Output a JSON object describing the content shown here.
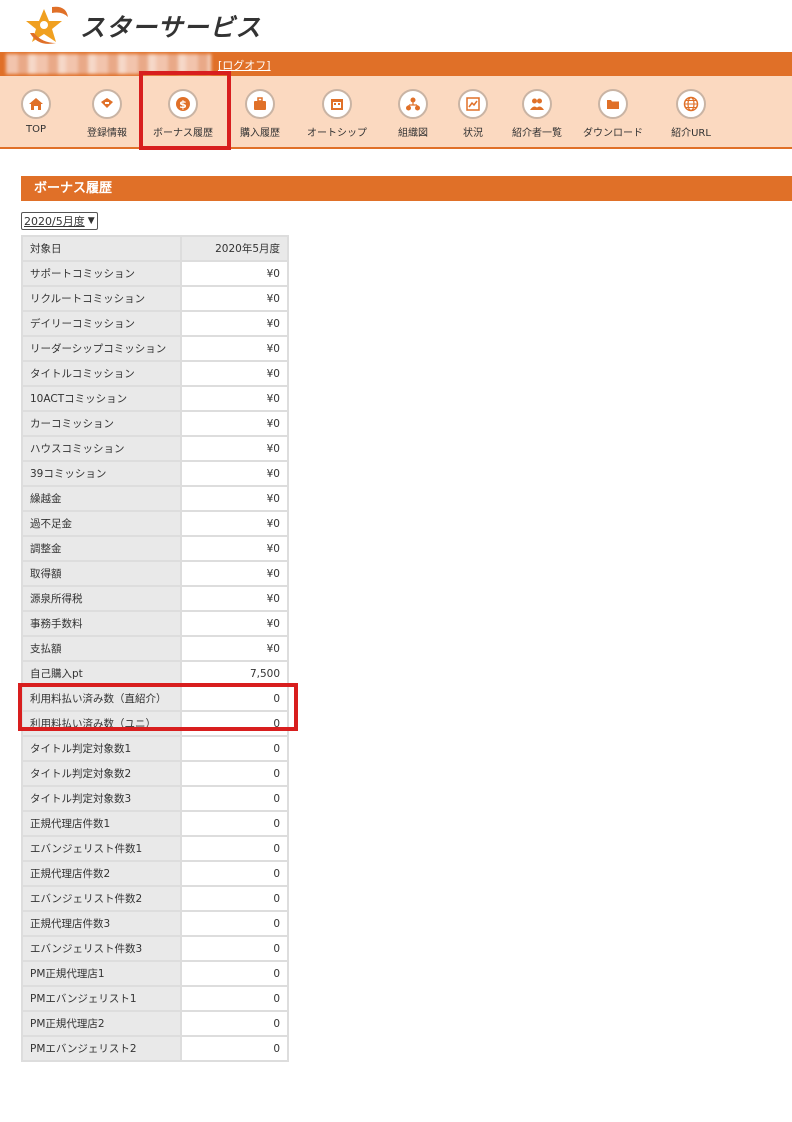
{
  "header": {
    "site_name": "スターサービス",
    "logoff_label": "[ログオフ]"
  },
  "nav": {
    "items": [
      {
        "label": "TOP",
        "icon": "home-icon"
      },
      {
        "label": "登録情報",
        "icon": "registration-icon"
      },
      {
        "label": "ボーナス履歴",
        "icon": "dollar-icon"
      },
      {
        "label": "購入履歴",
        "icon": "briefcase-icon"
      },
      {
        "label": "オートシップ",
        "icon": "calendar-icon"
      },
      {
        "label": "組織図",
        "icon": "org-chart-icon"
      },
      {
        "label": "状況",
        "icon": "chart-icon"
      },
      {
        "label": "紹介者一覧",
        "icon": "users-icon"
      },
      {
        "label": "ダウンロード",
        "icon": "folder-icon"
      },
      {
        "label": "紹介URL",
        "icon": "globe-icon"
      }
    ],
    "selected": "ボーナス履歴"
  },
  "page": {
    "title": "ボーナス履歴",
    "month_select": {
      "value": "2020/5月度"
    }
  },
  "table": {
    "rows": [
      {
        "label": "対象日",
        "value": "2020年5月度"
      },
      {
        "label": "サポートコミッション",
        "value": "¥0"
      },
      {
        "label": "リクルートコミッション",
        "value": "¥0"
      },
      {
        "label": "デイリーコミッション",
        "value": "¥0"
      },
      {
        "label": "リーダーシップコミッション",
        "value": "¥0"
      },
      {
        "label": "タイトルコミッション",
        "value": "¥0"
      },
      {
        "label": "10ACTコミッション",
        "value": "¥0"
      },
      {
        "label": "カーコミッション",
        "value": "¥0"
      },
      {
        "label": "ハウスコミッション",
        "value": "¥0"
      },
      {
        "label": "39コミッション",
        "value": "¥0"
      },
      {
        "label": "繰越金",
        "value": "¥0"
      },
      {
        "label": "過不足金",
        "value": "¥0"
      },
      {
        "label": "調整金",
        "value": "¥0"
      },
      {
        "label": "取得額",
        "value": "¥0"
      },
      {
        "label": "源泉所得税",
        "value": "¥0"
      },
      {
        "label": "事務手数料",
        "value": "¥0"
      },
      {
        "label": "支払額",
        "value": "¥0"
      },
      {
        "label": "自己購入pt",
        "value": "7,500"
      },
      {
        "label": "利用料払い済み数（直紹介）",
        "value": "0"
      },
      {
        "label": "利用料払い済み数（ユニ）",
        "value": "0"
      },
      {
        "label": "タイトル判定対象数1",
        "value": "0"
      },
      {
        "label": "タイトル判定対象数2",
        "value": "0"
      },
      {
        "label": "タイトル判定対象数3",
        "value": "0"
      },
      {
        "label": "正規代理店件数1",
        "value": "0"
      },
      {
        "label": "エバンジェリスト件数1",
        "value": "0"
      },
      {
        "label": "正規代理店件数2",
        "value": "0"
      },
      {
        "label": "エバンジェリスト件数2",
        "value": "0"
      },
      {
        "label": "正規代理店件数3",
        "value": "0"
      },
      {
        "label": "エバンジェリスト件数3",
        "value": "0"
      },
      {
        "label": "PM正規代理店1",
        "value": "0"
      },
      {
        "label": "PMエバンジェリスト1",
        "value": "0"
      },
      {
        "label": "PM正規代理店2",
        "value": "0"
      },
      {
        "label": "PMエバンジェリスト2",
        "value": "0"
      }
    ]
  },
  "colors": {
    "accent": "#e07028",
    "nav_background": "#fbd9c0",
    "highlight": "#d81e1e"
  }
}
